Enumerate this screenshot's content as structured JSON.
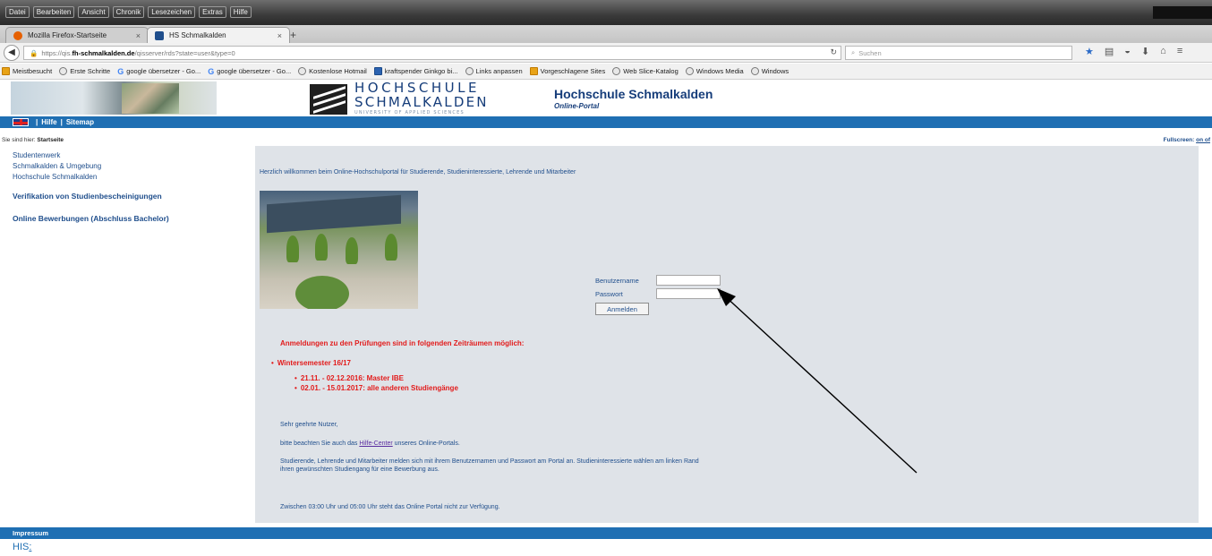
{
  "browser": {
    "menus": [
      "Datei",
      "Bearbeiten",
      "Ansicht",
      "Chronik",
      "Lesezeichen",
      "Extras",
      "Hilfe"
    ],
    "tabs": [
      {
        "title": "Mozilla Firefox-Startseite",
        "active": false
      },
      {
        "title": "HS Schmalkalden",
        "active": true
      }
    ],
    "url_prefix": "https://qis.",
    "url_host": "fh-schmalkalden.de",
    "url_path": "/qisserver/rds?state=user&type=0",
    "search_placeholder": "Suchen",
    "bookmarks": [
      "Meistbesucht",
      "Erste Schritte",
      "google übersetzer - Go...",
      "google übersetzer - Go...",
      "Kostenlose Hotmail",
      "kraftspender Ginkgo bi...",
      "Links anpassen",
      "Vorgeschlagene Sites",
      "Web Slice-Katalog",
      "Windows Media",
      "Windows"
    ]
  },
  "header": {
    "logo_line1": "HOCHSCHULE",
    "logo_line2": "SCHMALKALDEN",
    "logo_line3": "UNIVERSITY OF APPLIED SCIENCES",
    "title": "Hochschule Schmalkalden",
    "subtitle": "Online-Portal"
  },
  "topnav": {
    "help": "Hilfe",
    "sep": "|",
    "sitemap": "Sitemap"
  },
  "breadcrumb": {
    "prefix": "Sie sind hier:",
    "current": "Startseite"
  },
  "fullscreen": {
    "label": "Fullscreen:",
    "link": "on of"
  },
  "sidebar": {
    "links": [
      "Studentenwerk",
      "Schmalkalden & Umgebung",
      "Hochschule Schmalkalden"
    ],
    "bold_links": [
      "Verifikation von Studienbescheinigungen",
      "Online Bewerbungen (Abschluss Bachelor)"
    ]
  },
  "main": {
    "welcome": "Herzlich willkommen beim Online-Hochschulportal für Studierende, Studieninteressierte, Lehrende und Mitarbeiter",
    "login": {
      "username_label": "Benutzername",
      "password_label": "Passwort",
      "submit": "Anmelden"
    },
    "exam_heading": "Anmeldungen zu den Prüfungen sind in folgenden Zeiträumen möglich:",
    "semester": "Wintersemester 16/17",
    "periods": [
      "21.11. - 02.12.2016: Master IBE",
      "02.01. - 15.01.2017: alle anderen Studiengänge"
    ],
    "greeting": "Sehr geehrte Nutzer,",
    "help_before": "bitte beachten Sie auch das ",
    "help_link": "Hilfe-Center",
    "help_after": " unseres Online-Portals.",
    "instructions": "Studierende, Lehrende und Mitarbeiter melden sich mit ihrem Benutzernamen und Passwort am Portal an. Studieninteressierte wählen am linken Rand ihren gewünschten Studiengang für eine Bewerbung aus.",
    "downtime": "Zwischen 03:00 Uhr und 05:00 Uhr steht das Online Portal nicht zur Verfügung."
  },
  "footer": {
    "impressum": "Impressum",
    "his": "HIS",
    "his_suffix": ":"
  },
  "colors": {
    "blue_bar": "#1f6fb3",
    "content_bg": "#dfe3e8",
    "accent_red": "#e21b1b",
    "link_blue": "#1f4e8c"
  }
}
